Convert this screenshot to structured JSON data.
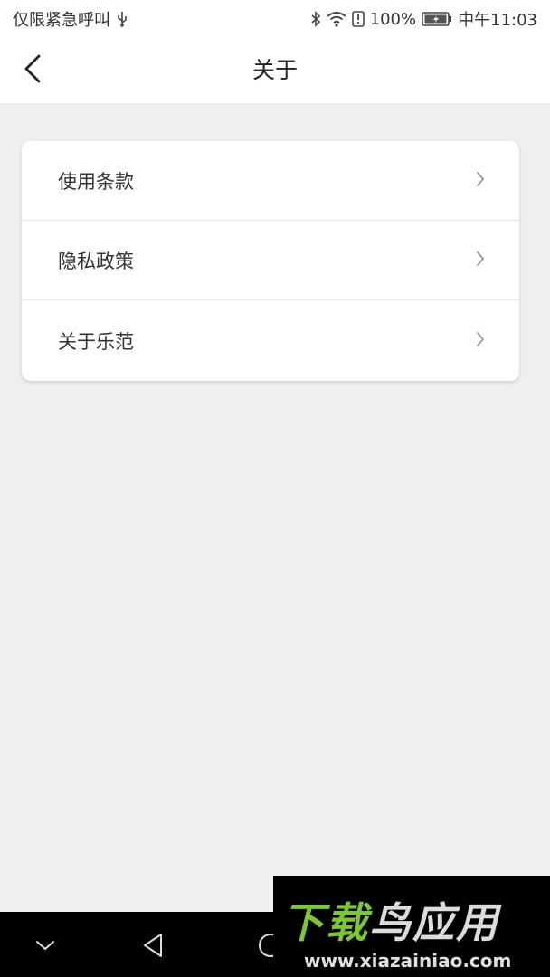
{
  "status_bar": {
    "left_text": "仅限紧急呼叫",
    "battery_text": "100%",
    "time": "中午11:03",
    "icons": [
      "usb-icon",
      "bluetooth-icon",
      "wifi-icon",
      "alert-icon",
      "battery-icon"
    ]
  },
  "header": {
    "title": "关于",
    "back_icon": "chevron-left-icon"
  },
  "menu": {
    "items": [
      {
        "label": "使用条款"
      },
      {
        "label": "隐私政策"
      },
      {
        "label": "关于乐范"
      }
    ]
  },
  "nav_bar": {
    "icons": [
      "chevron-down-icon",
      "back-triangle-icon",
      "home-circle-icon"
    ]
  },
  "watermark": {
    "title_first": "下载",
    "title_rest": "鸟应用",
    "url": "www.xiazainiao.com"
  },
  "colors": {
    "background": "#efefef",
    "card": "#ffffff",
    "watermark_green": "#7cc832"
  }
}
